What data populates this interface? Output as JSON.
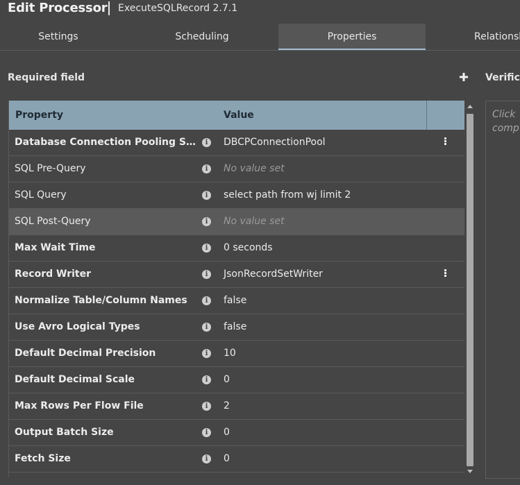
{
  "dialog": {
    "title": "Edit Processor",
    "subtitle": "ExecuteSQLRecord 2.7.1"
  },
  "tabs": [
    {
      "label": "Settings",
      "active": false
    },
    {
      "label": "Scheduling",
      "active": false
    },
    {
      "label": "Properties",
      "active": true
    },
    {
      "label": "Relationsh",
      "active": false
    }
  ],
  "properties_panel": {
    "required_label": "Required field",
    "add_icon": "plus-icon",
    "columns": {
      "property": "Property",
      "value": "Value"
    },
    "rows": [
      {
        "property": "Database Connection Pooling Ser…",
        "value": "DBCPConnectionPool",
        "required": true,
        "empty": false,
        "has_menu": true
      },
      {
        "property": "SQL Pre-Query",
        "value": "No value set",
        "required": false,
        "empty": true,
        "has_menu": false
      },
      {
        "property": "SQL Query",
        "value": "select path from wj limit 2",
        "required": false,
        "empty": false,
        "has_menu": false
      },
      {
        "property": "SQL Post-Query",
        "value": "No value set",
        "required": false,
        "empty": true,
        "has_menu": false,
        "highlighted": true
      },
      {
        "property": "Max Wait Time",
        "value": "0 seconds",
        "required": true,
        "empty": false,
        "has_menu": false
      },
      {
        "property": "Record Writer",
        "value": "JsonRecordSetWriter",
        "required": true,
        "empty": false,
        "has_menu": true
      },
      {
        "property": "Normalize Table/Column Names",
        "value": "false",
        "required": true,
        "empty": false,
        "has_menu": false
      },
      {
        "property": "Use Avro Logical Types",
        "value": "false",
        "required": true,
        "empty": false,
        "has_menu": false
      },
      {
        "property": "Default Decimal Precision",
        "value": "10",
        "required": true,
        "empty": false,
        "has_menu": false
      },
      {
        "property": "Default Decimal Scale",
        "value": "0",
        "required": true,
        "empty": false,
        "has_menu": false
      },
      {
        "property": "Max Rows Per Flow File",
        "value": "2",
        "required": true,
        "empty": false,
        "has_menu": false
      },
      {
        "property": "Output Batch Size",
        "value": "0",
        "required": true,
        "empty": false,
        "has_menu": false
      },
      {
        "property": "Fetch Size",
        "value": "0",
        "required": true,
        "empty": false,
        "has_menu": false
      }
    ]
  },
  "verification": {
    "label": "Verific",
    "hint": "Click comp"
  },
  "colors": {
    "background": "#454545",
    "header": "#8aa3b3",
    "tab_active_underline": "#a7bfd3",
    "empty_value": "#9a9a9a"
  }
}
